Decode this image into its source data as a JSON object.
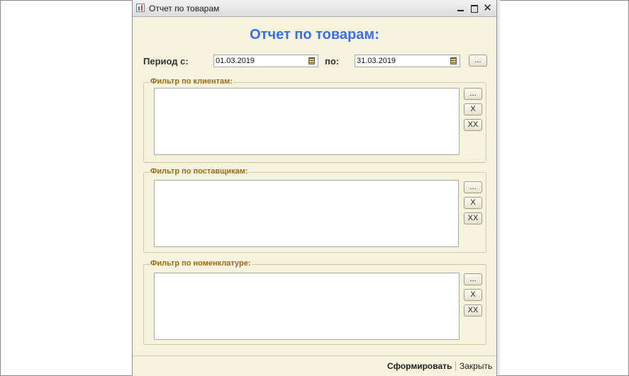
{
  "window": {
    "title": "Отчет по товарам"
  },
  "report": {
    "heading": "Отчет по товарам:",
    "period_from_label": "Период с:",
    "period_from_value": "01.03.2019",
    "period_to_label": "по:",
    "period_to_value": "31.03.2019",
    "period_select_button": "..."
  },
  "filters": [
    {
      "title": "Фильтр по клиентам:",
      "select_button": "...",
      "remove_button": "X",
      "clear_button": "XX"
    },
    {
      "title": "Фильтр по поставщикам:",
      "select_button": "...",
      "remove_button": "X",
      "clear_button": "XX"
    },
    {
      "title": "Фильтр по номенклатуре:",
      "select_button": "...",
      "remove_button": "X",
      "clear_button": "XX"
    }
  ],
  "footer": {
    "generate_button": "Сформировать",
    "close_button": "Закрыть"
  },
  "colors": {
    "window_bg": "#f5f2de",
    "heading": "#3a6ee8",
    "group_title": "#9b6a12"
  },
  "icons": [
    "report-app-icon",
    "minimize-icon",
    "maximize-icon",
    "close-icon",
    "calendar-icon"
  ]
}
